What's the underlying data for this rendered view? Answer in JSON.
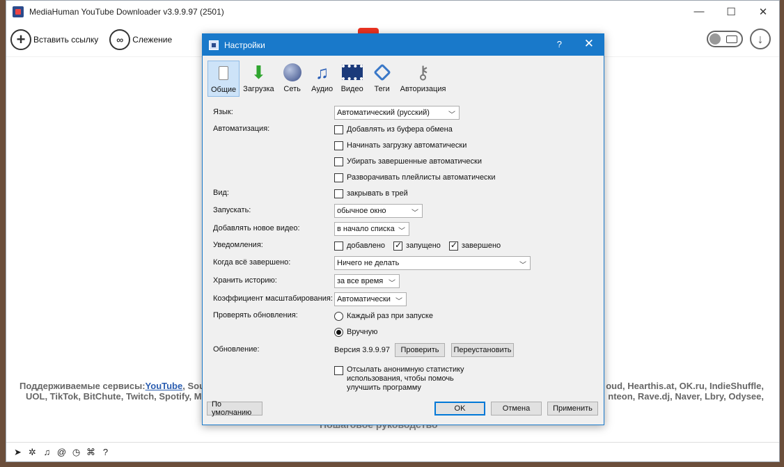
{
  "app": {
    "title": "MediaHuman YouTube Downloader v3.9.9.97 (2501)",
    "win_minimize": "—",
    "win_maximize": "☐",
    "win_close": "✕"
  },
  "toolbar": {
    "paste_link": "Вставить ссылку",
    "tracking": "Слежение"
  },
  "services": {
    "label": "Поддерживаемые сервисы:",
    "link": "YouTube",
    "line1_left": ", Soun",
    "line1_right": "oud, Hearthis.at, OK.ru, IndieShuffle,",
    "line2_left": "UOL, TikTok, BitChute, Twitch, Spotify, M",
    "line2_right": "nteon, Rave.dj, Naver, Lbry, Odysee,"
  },
  "guide": "Пошаговое руководство",
  "dialog": {
    "title": "Настройки",
    "help": "?",
    "close": "✕",
    "tabs": [
      {
        "label": "Общие",
        "icon": "general-icon"
      },
      {
        "label": "Загрузка",
        "icon": "download-icon"
      },
      {
        "label": "Сеть",
        "icon": "globe-icon"
      },
      {
        "label": "Аудио",
        "icon": "music-note-icon"
      },
      {
        "label": "Видео",
        "icon": "film-icon"
      },
      {
        "label": "Теги",
        "icon": "tag-icon"
      },
      {
        "label": "Авторизация",
        "icon": "keys-icon"
      }
    ],
    "language": {
      "label": "Язык:",
      "value": "Автоматический (русский)"
    },
    "automation": {
      "label": "Автоматизация:",
      "options": [
        {
          "text": "Добавлять из буфера обмена",
          "checked": false
        },
        {
          "text": "Начинать загрузку автоматически",
          "checked": false
        },
        {
          "text": "Убирать завершенные автоматически",
          "checked": false
        },
        {
          "text": "Разворачивать плейлисты автоматически",
          "checked": false
        }
      ]
    },
    "view": {
      "label": "Вид:",
      "option": "закрывать в трей",
      "checked": false
    },
    "launch": {
      "label": "Запускать:",
      "value": "обычное окно"
    },
    "add_new_video": {
      "label": "Добавлять новое видео:",
      "value": "в начало списка"
    },
    "notifications": {
      "label": "Уведомления:",
      "options": [
        {
          "text": "добавлено",
          "checked": false
        },
        {
          "text": "запущено",
          "checked": true
        },
        {
          "text": "завершено",
          "checked": true
        }
      ]
    },
    "when_done": {
      "label": "Когда всё завершено:",
      "value": "Ничего не делать"
    },
    "history": {
      "label": "Хранить историю:",
      "value": "за все время"
    },
    "scale": {
      "label": "Коэффициент масштабирования:",
      "value": "Автоматически"
    },
    "updates_check": {
      "label": "Проверять обновления:",
      "options": [
        {
          "text": "Каждый раз при запуске",
          "selected": false
        },
        {
          "text": "Вручную",
          "selected": true
        }
      ]
    },
    "update": {
      "label": "Обновление:",
      "version": "Версия 3.9.9.97",
      "check_button": "Проверить",
      "reinstall_button": "Переустановить"
    },
    "stats": {
      "line1": "Отсылать анонимную статистику",
      "line2": "использования, чтобы помочь",
      "line3": "улучшить программу",
      "checked": false
    },
    "buttons": {
      "defaults": "По умолчанию",
      "ok": "OK",
      "cancel": "Отмена",
      "apply": "Применить"
    }
  },
  "bottombar": {
    "icons": [
      "telegram-icon",
      "settings-icon",
      "music-icon",
      "snail-icon",
      "clock-icon",
      "binoculars-icon",
      "help-icon"
    ],
    "help": "?"
  }
}
